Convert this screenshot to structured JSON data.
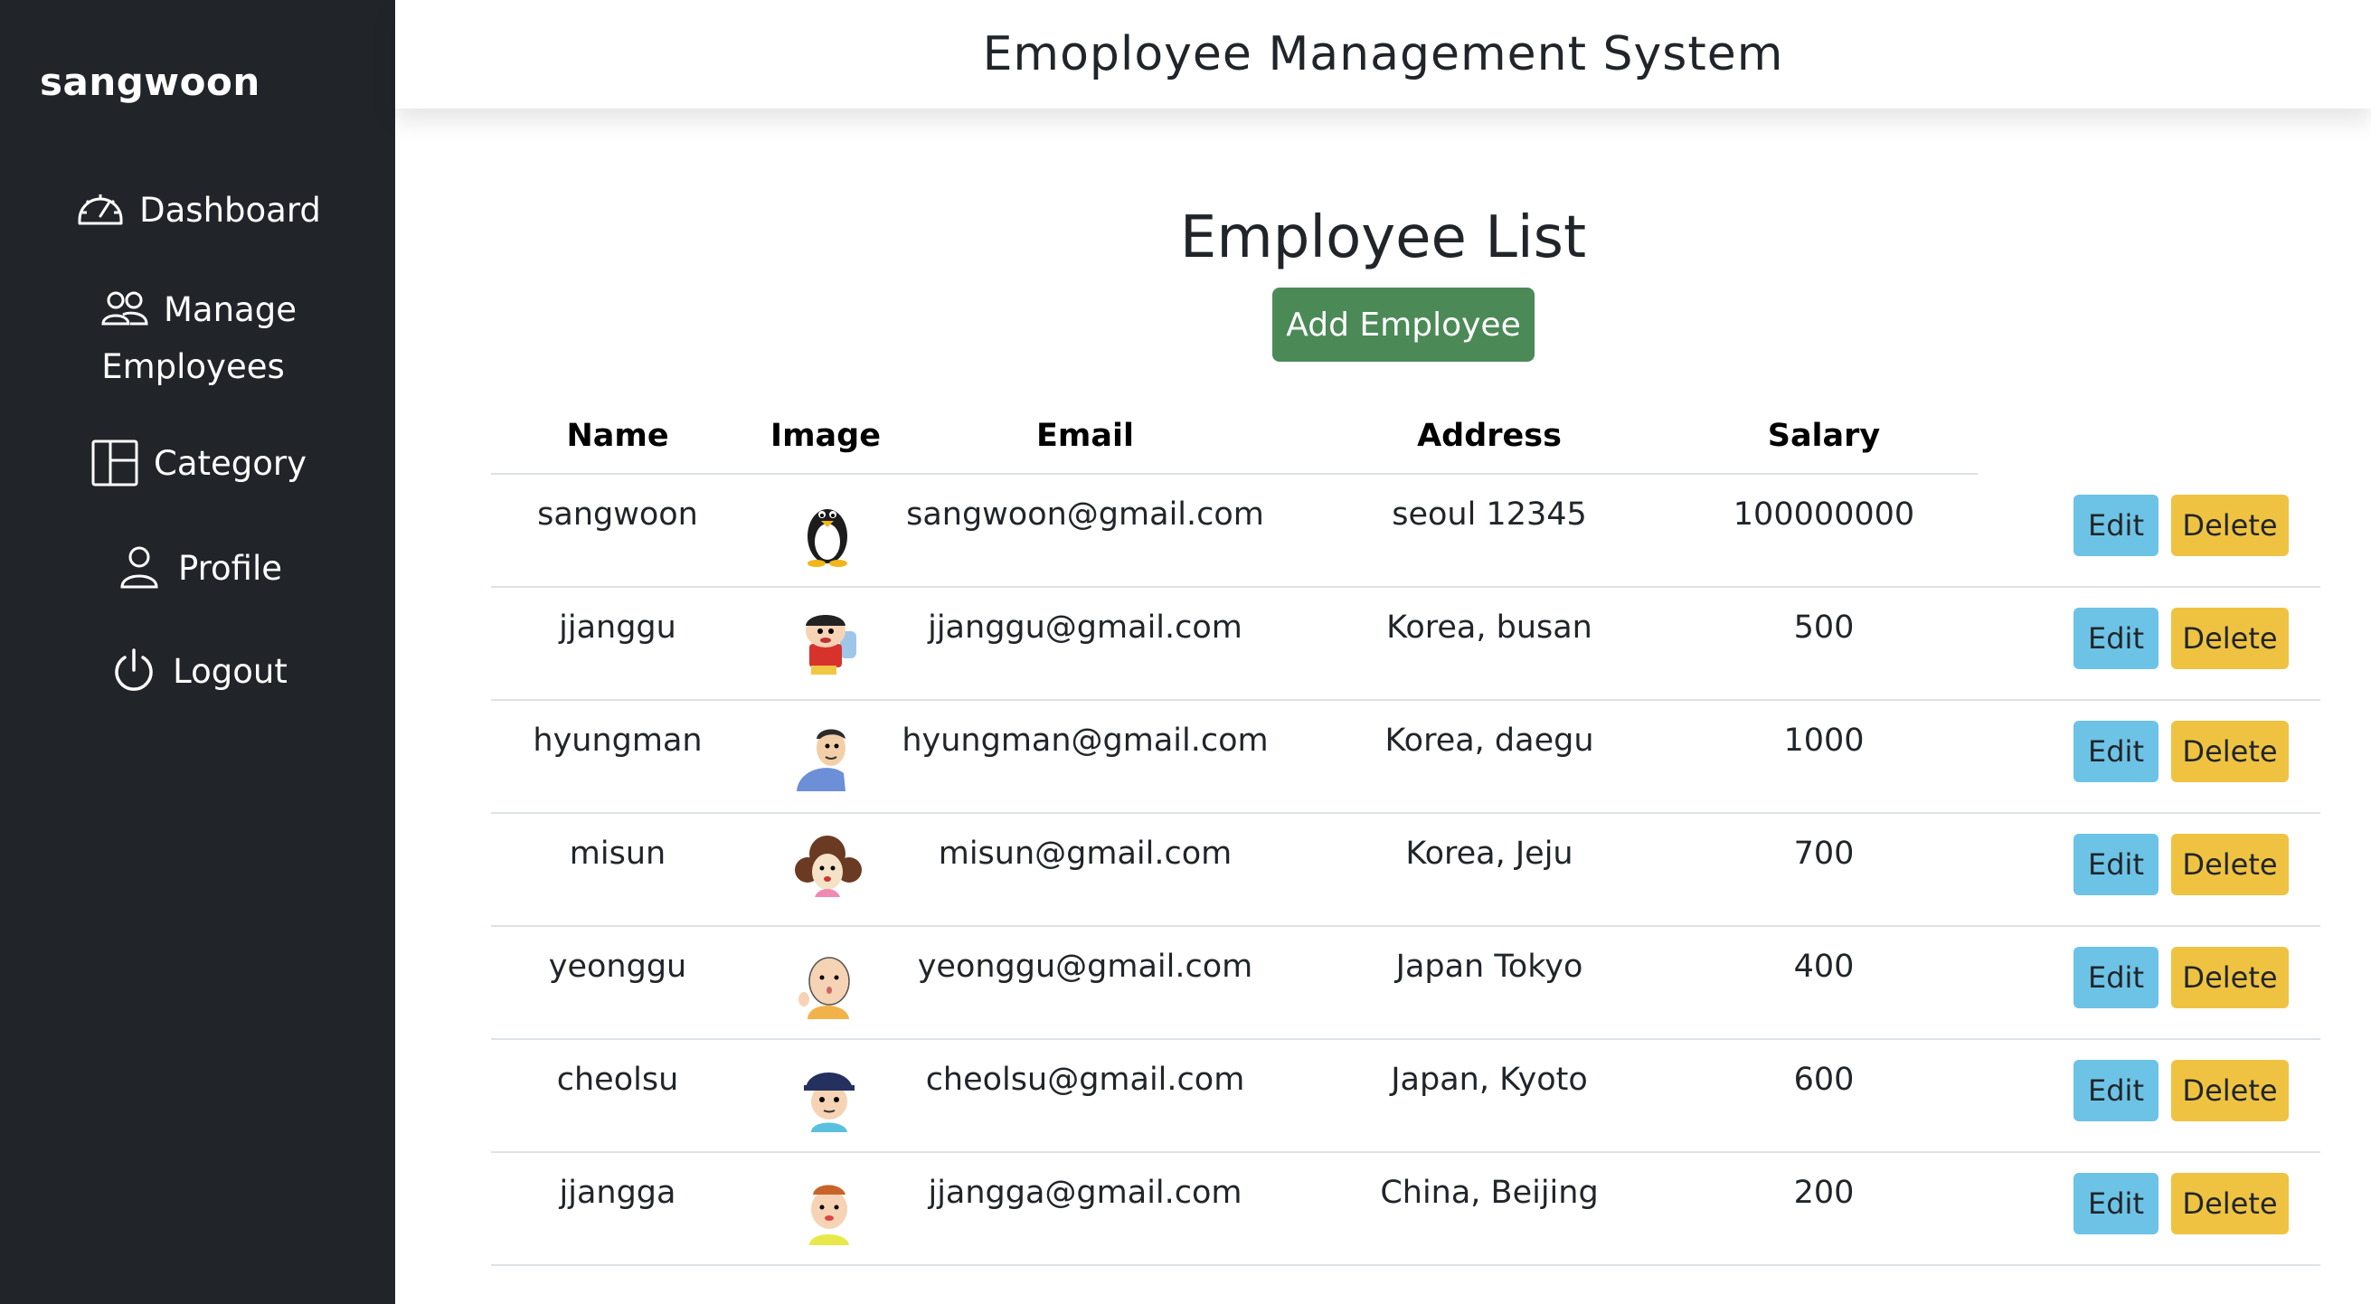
{
  "sidebar": {
    "brand": "sangwoon",
    "items": [
      {
        "label": "Dashboard",
        "icon": "speedometer-icon"
      },
      {
        "label_line1": "Manage",
        "label_line2": "Employees",
        "icon": "people-icon"
      },
      {
        "label": "Category",
        "icon": "columns-icon"
      },
      {
        "label": "Profile",
        "icon": "person-icon"
      },
      {
        "label": "Logout",
        "icon": "power-icon"
      }
    ]
  },
  "header": {
    "title": "Emoployee Management System"
  },
  "main": {
    "title": "Employee List",
    "add_button": "Add Employee",
    "columns": [
      "Name",
      "Image",
      "Email",
      "Address",
      "Salary"
    ],
    "edit_label": "Edit",
    "delete_label": "Delete",
    "rows": [
      {
        "name": "sangwoon",
        "image": "penguin-avatar",
        "email": "sangwoon@gmail.com",
        "address": "seoul 12345",
        "salary": "100000000"
      },
      {
        "name": "jjanggu",
        "image": "boy-cartoon-avatar",
        "email": "jjanggu@gmail.com",
        "address": "Korea, busan",
        "salary": "500"
      },
      {
        "name": "hyungman",
        "image": "man-cartoon-avatar",
        "email": "hyungman@gmail.com",
        "address": "Korea, daegu",
        "salary": "1000"
      },
      {
        "name": "misun",
        "image": "woman-cartoon-avatar",
        "email": "misun@gmail.com",
        "address": "Korea, Jeju",
        "salary": "700"
      },
      {
        "name": "yeonggu",
        "image": "baby-cartoon-avatar",
        "email": "yeonggu@gmail.com",
        "address": "Japan Tokyo",
        "salary": "400"
      },
      {
        "name": "cheolsu",
        "image": "kid-cap-cartoon-avatar",
        "email": "cheolsu@gmail.com",
        "address": "Japan, Kyoto",
        "salary": "600"
      },
      {
        "name": "jjangga",
        "image": "infant-cartoon-avatar",
        "email": "jjangga@gmail.com",
        "address": "China, Beijing",
        "salary": "200"
      }
    ]
  },
  "colors": {
    "sidebar_bg": "#212529",
    "add_button": "#4b8a57",
    "edit_button": "#6cc3e6",
    "delete_button": "#efc341"
  }
}
